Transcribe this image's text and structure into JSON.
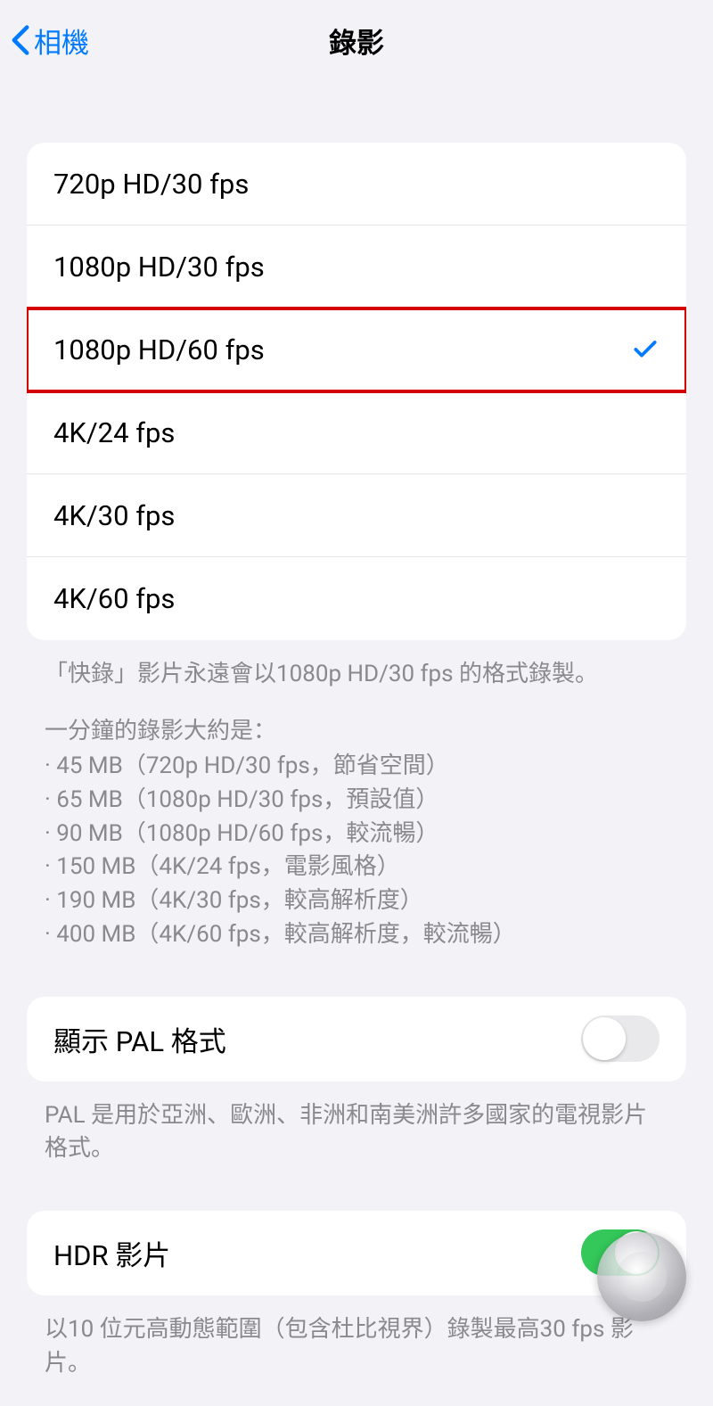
{
  "nav": {
    "back_label": "相機",
    "title": "錄影"
  },
  "resolutions": [
    {
      "label": "720p HD/30 fps",
      "selected": false,
      "highlight": false
    },
    {
      "label": "1080p HD/30 fps",
      "selected": false,
      "highlight": false
    },
    {
      "label": "1080p HD/60 fps",
      "selected": true,
      "highlight": true
    },
    {
      "label": "4K/24 fps",
      "selected": false,
      "highlight": false
    },
    {
      "label": "4K/30 fps",
      "selected": false,
      "highlight": false
    },
    {
      "label": "4K/60 fps",
      "selected": false,
      "highlight": false
    }
  ],
  "footer1": "「快錄」影片永遠會以1080p HD/30 fps 的格式錄製。",
  "sizes_intro": "一分鐘的錄影大約是：",
  "sizes": [
    "· 45 MB（720p HD/30 fps，節省空間）",
    "· 65 MB（1080p HD/30 fps，預設值）",
    "· 90 MB（1080p HD/60 fps，較流暢）",
    "· 150 MB（4K/24 fps，電影風格）",
    "· 190 MB（4K/30 fps，較高解析度）",
    "· 400 MB（4K/60 fps，較高解析度，較流暢）"
  ],
  "pal": {
    "label": "顯示 PAL 格式",
    "enabled": false,
    "footer": "PAL 是用於亞洲、歐洲、非洲和南美洲許多國家的電視影片格式。"
  },
  "hdr": {
    "label": "HDR 影片",
    "enabled": true,
    "footer": "以10 位元高動態範圍（包含杜比視界）錄製最高30 fps 影片。"
  }
}
